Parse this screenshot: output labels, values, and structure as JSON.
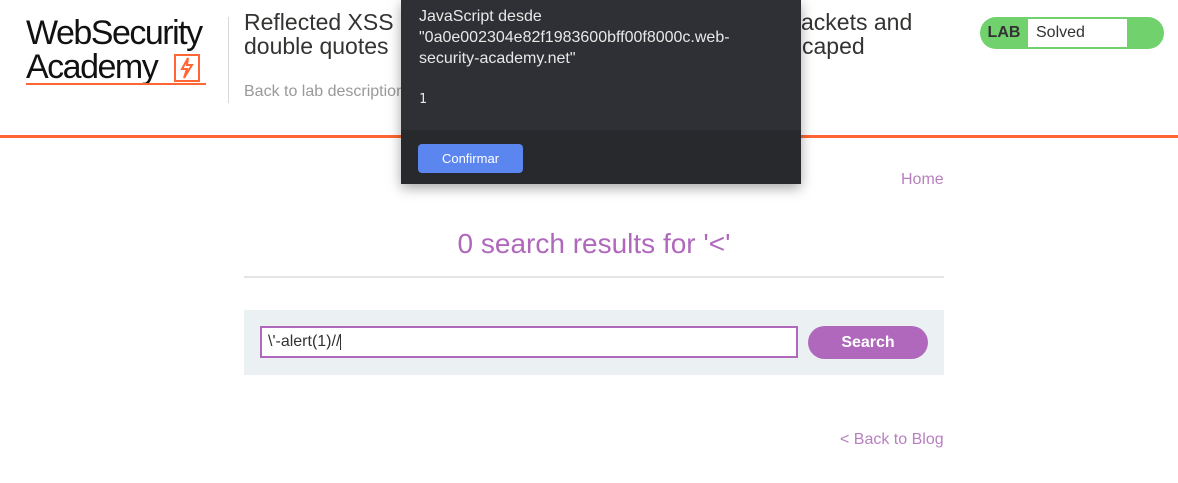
{
  "header": {
    "logo_line1": "WebSecurity",
    "logo_line2": "Academy",
    "lab_title_left": "Reflected XSS",
    "lab_title_left2": "double quotes",
    "lab_title_right": "ackets and",
    "lab_title_right2": "caped",
    "back_description": "Back to lab description",
    "lab_badge": "LAB",
    "lab_status": "Solved"
  },
  "nav": {
    "home": "Home"
  },
  "main": {
    "results_heading": "0 search results for '<'",
    "search_value": "\\'-alert(1)//",
    "search_button": "Search",
    "back_to_blog": "< Back to Blog"
  },
  "dialog": {
    "message": "JavaScript desde \"0a0e002304e82f1983600bff00f8000c.web-security-academy.net\"",
    "value": "1",
    "confirm": "Confirmar"
  },
  "colors": {
    "accent_orange": "#ff6633",
    "accent_purple": "#b068bc",
    "solved_green": "#70d16d",
    "dialog_bg": "#2f3035",
    "dialog_button": "#5b86f0"
  }
}
